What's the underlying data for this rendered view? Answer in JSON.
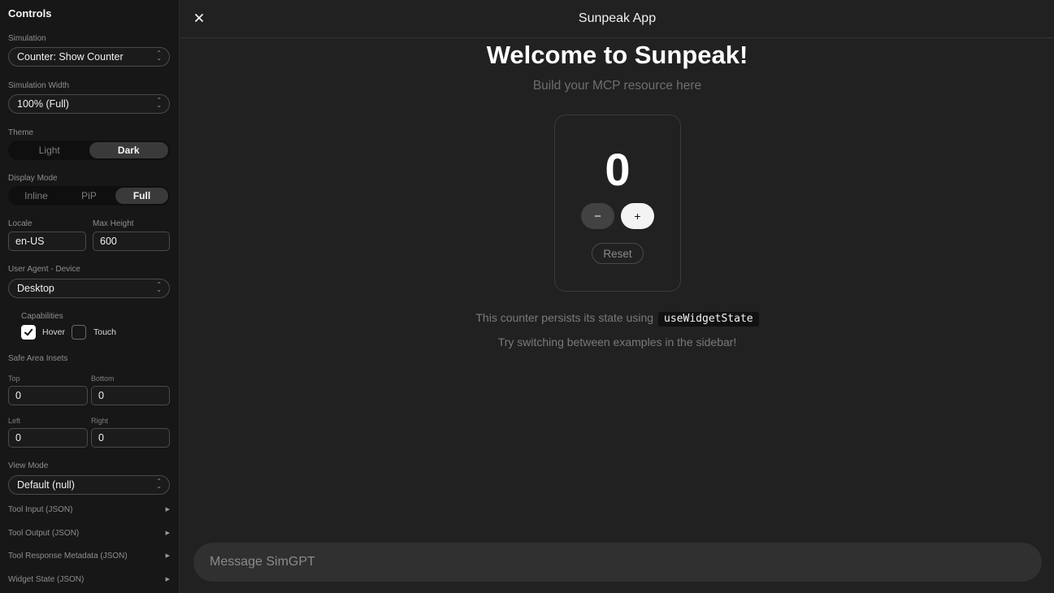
{
  "sidebar": {
    "title": "Controls",
    "simulation": {
      "label": "Simulation",
      "value": "Counter: Show Counter"
    },
    "simulation_width": {
      "label": "Simulation Width",
      "value": "100% (Full)"
    },
    "theme": {
      "label": "Theme",
      "options": [
        "Light",
        "Dark"
      ],
      "selected": "Dark"
    },
    "display_mode": {
      "label": "Display Mode",
      "options": [
        "Inline",
        "PiP",
        "Full"
      ],
      "selected": "Full"
    },
    "locale": {
      "label": "Locale",
      "value": "en-US"
    },
    "max_height": {
      "label": "Max Height",
      "value": "600"
    },
    "user_agent": {
      "label": "User Agent - Device",
      "value": "Desktop"
    },
    "capabilities": {
      "label": "Capabilities",
      "hover_label": "Hover",
      "hover_checked": true,
      "touch_label": "Touch",
      "touch_checked": false
    },
    "safe_area": {
      "label": "Safe Area Insets",
      "top_label": "Top",
      "top_value": "0",
      "bottom_label": "Bottom",
      "bottom_value": "0",
      "left_label": "Left",
      "left_value": "0",
      "right_label": "Right",
      "right_value": "0"
    },
    "view_mode": {
      "label": "View Mode",
      "value": "Default (null)"
    },
    "collapsibles": [
      "Tool Input (JSON)",
      "Tool Output (JSON)",
      "Tool Response Metadata (JSON)",
      "Widget State (JSON)"
    ]
  },
  "main": {
    "app_title": "Sunpeak App",
    "welcome": "Welcome to Sunpeak!",
    "subtitle": "Build your MCP resource here",
    "counter_value": "0",
    "minus_label": "−",
    "plus_label": "+",
    "reset_label": "Reset",
    "info_text": "This counter persists its state using",
    "info_code": "useWidgetState",
    "hint_text": "Try switching between examples in the sidebar!",
    "message_placeholder": "Message SimGPT"
  },
  "icons": {
    "close": "close-icon",
    "chevron": "chevron-updown-icon",
    "expand": "triangle-right-icon",
    "check": "check-icon"
  }
}
